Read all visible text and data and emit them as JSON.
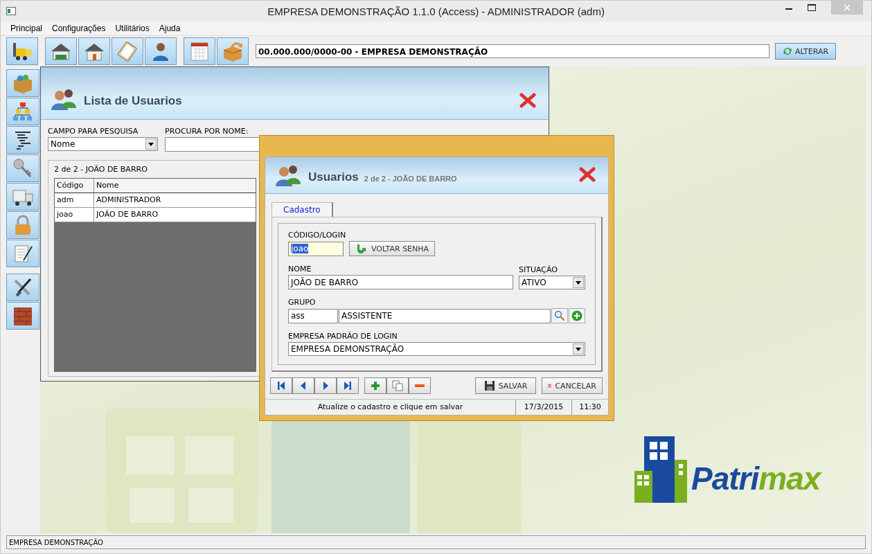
{
  "window": {
    "title": "EMPRESA DEMONSTRAÇÃO 1.1.0 (Access) - ADMINISTRADOR (adm)"
  },
  "menu": [
    "Principal",
    "Configurações",
    "Utilitários",
    "Ajuda"
  ],
  "toolbar": {
    "company": "00.000.000/0000-00 - EMPRESA DEMONSTRAÇÃO",
    "change_button": "ALTERAR"
  },
  "list_window": {
    "title": "Lista de Usuarios",
    "search_field_label": "CAMPO PARA PESQUISA",
    "search_field_value": "Nome",
    "search_name_label": "PROCURA POR NOME:",
    "record_label": "2 de 2 - JOÃO DE BARRO",
    "columns": [
      "Código",
      "Nome"
    ],
    "rows": [
      {
        "code": "adm",
        "name": "ADMINISTRADOR"
      },
      {
        "code": "joao",
        "name": "JOÃO DE BARRO"
      }
    ]
  },
  "dialog": {
    "title": "Usuarios",
    "subtitle": "2 de 2 - JOÃO DE BARRO",
    "tabs": [
      {
        "label": "Cadastro",
        "selected": true
      }
    ],
    "login_label": "CÓDIGO/LOGIN",
    "login_value": "joao",
    "login_text_selected": true,
    "reset_password_button": "VOLTAR SENHA",
    "name_label": "NOME",
    "name_value": "JOÃO DE BARRO",
    "status_label": "SITUAÇÃO",
    "status_value": "ATIVO",
    "group_label": "GRUPO",
    "group_code": "ass",
    "group_name": "ASSISTENTE",
    "company_label": "EMPRESA PADRÃO DE LOGIN",
    "company_value": "EMPRESA DEMONSTRAÇÃO",
    "save_button": "SALVAR",
    "cancel_button": "CANCELAR",
    "status_message": "Atualize o cadastro e clique em salvar",
    "status_date": "17/3/2015",
    "status_time": "11:30"
  },
  "logo": {
    "parts": [
      "Patri",
      "max"
    ]
  },
  "status_bar": "EMPRESA DEMONSTRAÇÃO"
}
